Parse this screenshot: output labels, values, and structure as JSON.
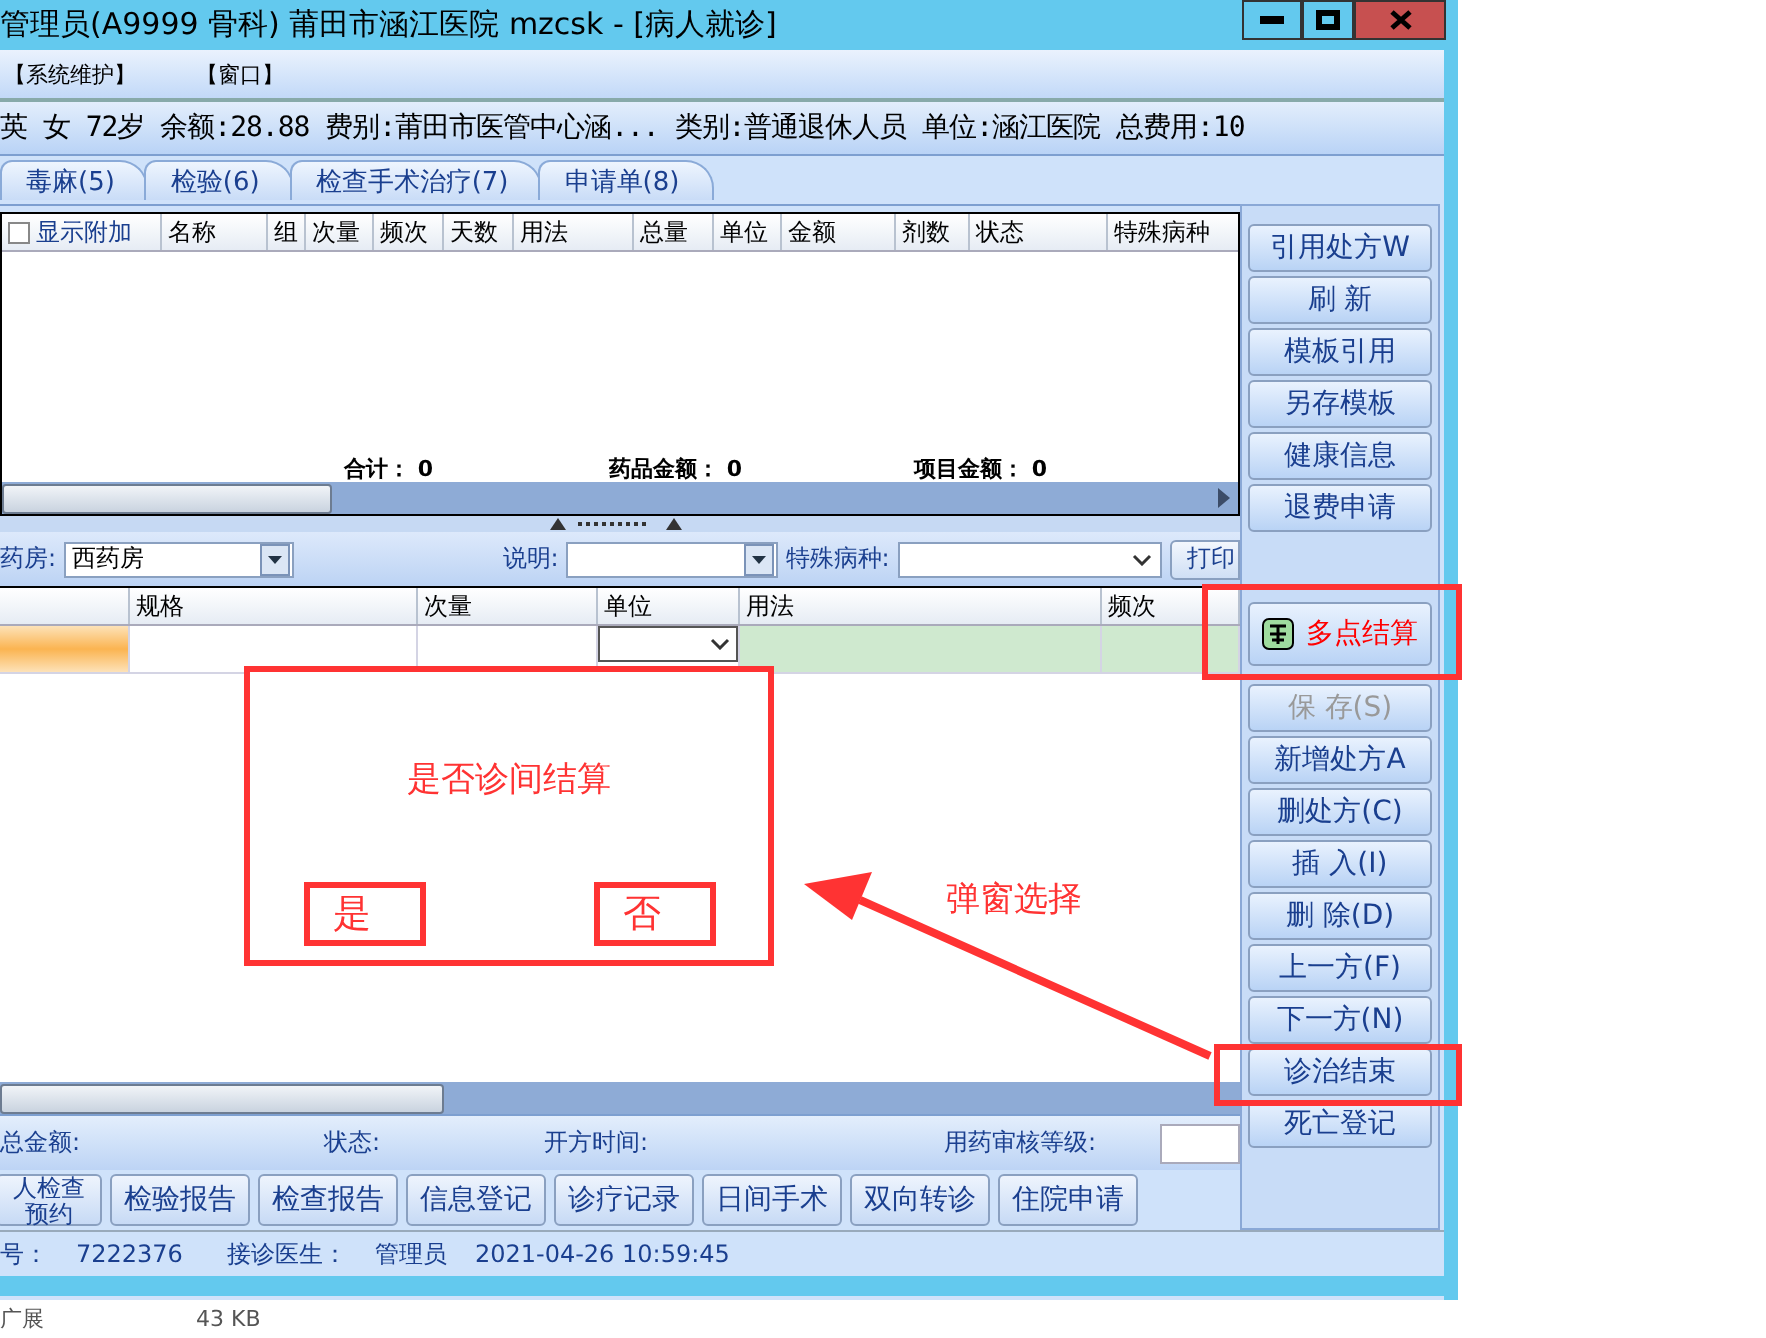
{
  "window": {
    "title": "管理员(A9999 骨科) 莆田市涵江医院 mzcsk - [病人就诊]"
  },
  "menu": [
    "【系统维护】",
    "【窗口】"
  ],
  "patient_info": "英 女 72岁 余额:28.88 费别:莆田市医管中心涵... 类别:普通退休人员 单位:涵江医院 总费用:10",
  "tabs": [
    {
      "label": "毒麻(5)",
      "selected": false
    },
    {
      "label": "检验(6)",
      "selected": false
    },
    {
      "label": "检查手术治疗(7)",
      "selected": false
    },
    {
      "label": "申请单(8)",
      "selected": false
    }
  ],
  "prescription_table": {
    "show_extra": {
      "label": "显示附加",
      "checked": false
    },
    "columns": [
      "名称",
      "组",
      "次量",
      "频次",
      "天数",
      "用法",
      "总量",
      "单位",
      "金额",
      "剂数",
      "状态",
      "特殊病种"
    ],
    "totals": [
      {
        "label": "合计：",
        "value": "0"
      },
      {
        "label": "药品金额：",
        "value": "0"
      },
      {
        "label": "项目金额：",
        "value": "0"
      }
    ]
  },
  "filter": {
    "pharmacy_label": "药房:",
    "pharmacy_value": "西药房",
    "note_label": "说明:",
    "special_label": "特殊病种:",
    "print_button": "打印"
  },
  "detail_table": {
    "columns": [
      "规格",
      "次量",
      "单位",
      "用法",
      "频次"
    ]
  },
  "side_buttons": [
    {
      "label": "引用处方W",
      "kind": "plain",
      "disabled": false
    },
    {
      "label": "刷 新",
      "kind": "plain",
      "disabled": false
    },
    {
      "label": "模板引用",
      "kind": "plain",
      "disabled": false
    },
    {
      "label": "另存模板",
      "kind": "plain",
      "disabled": false
    },
    {
      "label": "健康信息",
      "kind": "plain",
      "disabled": false
    },
    {
      "label": "退费申请",
      "kind": "plain",
      "disabled": false
    },
    {
      "label": "多点结算",
      "kind": "settle",
      "disabled": false
    },
    {
      "label": "保 存(S)",
      "kind": "plain",
      "disabled": true
    },
    {
      "label": "新增处方A",
      "kind": "plain",
      "disabled": false
    },
    {
      "label": "删处方(C)",
      "kind": "plain",
      "disabled": false
    },
    {
      "label": "插 入(I)",
      "kind": "plain",
      "disabled": false
    },
    {
      "label": "删 除(D)",
      "kind": "plain",
      "disabled": false
    },
    {
      "label": "上一方(F)",
      "kind": "plain",
      "disabled": false
    },
    {
      "label": "下一方(N)",
      "kind": "plain",
      "disabled": false
    },
    {
      "label": "诊治结束",
      "kind": "plain",
      "disabled": false
    },
    {
      "label": "死亡登记",
      "kind": "plain",
      "disabled": false
    }
  ],
  "status_fields": [
    "总金额:",
    "状态:",
    "开方时间:",
    "用药审核等级:"
  ],
  "bottom_buttons": [
    "人检查预约",
    "检验报告",
    "检查报告",
    "信息登记",
    "诊疗记录",
    "日间手术",
    "双向转诊",
    "住院申请"
  ],
  "info": {
    "reg_label": "号：",
    "reg_no": "7222376",
    "doctor_label": "接诊医生：",
    "doctor": "管理员",
    "time": "2021-04-26 10:59:45"
  },
  "annotation": {
    "dialog_title": "是否诊间结算",
    "yes": "是",
    "no": "否",
    "callout": "弹窗选择"
  },
  "file_row": {
    "name": "广展",
    "size": "43 KB"
  }
}
